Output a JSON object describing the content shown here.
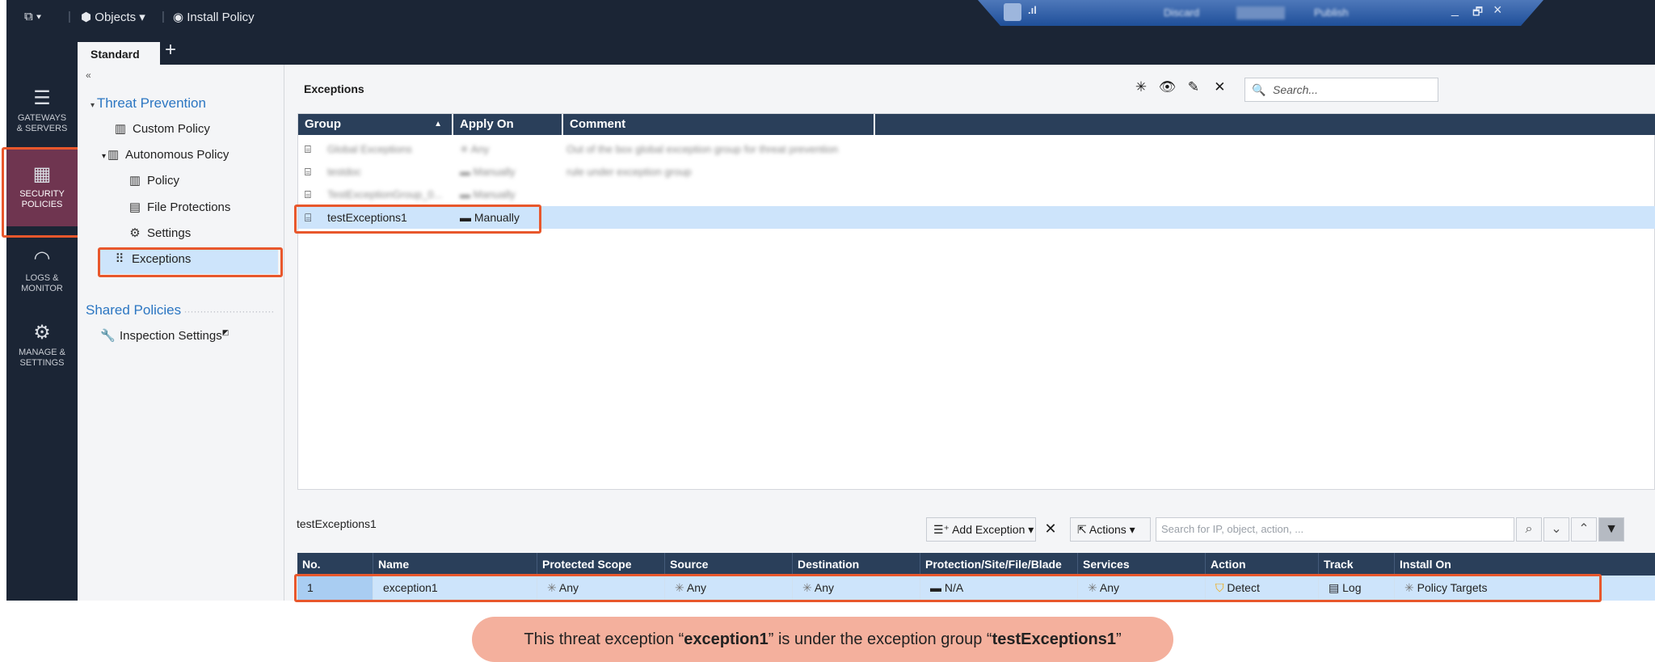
{
  "topbar": {
    "app_menu_icon": "app-menu-icon",
    "objects_label": "Objects",
    "install_policy_label": "Install Policy",
    "discard_label": "Discard",
    "publish_label": "Publish",
    "minimize": "_",
    "restore": "🗗",
    "close": "×"
  },
  "tabs": {
    "active": "Standard",
    "add": "+"
  },
  "leftnav": [
    {
      "label_line1": "GATEWAYS",
      "label_line2": "& SERVERS",
      "icon": "server-icon"
    },
    {
      "label_line1": "SECURITY",
      "label_line2": "POLICIES",
      "icon": "policy-grid-icon"
    },
    {
      "label_line1": "LOGS &",
      "label_line2": "MONITOR",
      "icon": "gauge-icon"
    },
    {
      "label_line1": "MANAGE &",
      "label_line2": "SETTINGS",
      "icon": "gear-icon"
    }
  ],
  "tree": {
    "collapse": "«",
    "threat_prevention": "Threat Prevention",
    "custom_policy": "Custom Policy",
    "autonomous_policy": "Autonomous Policy",
    "policy": "Policy",
    "file_protections": "File Protections",
    "settings": "Settings",
    "exceptions": "Exceptions",
    "shared_policies": "Shared Policies",
    "inspection_settings": "Inspection Settings"
  },
  "exceptions_panel": {
    "title": "Exceptions",
    "search_placeholder": "Search...",
    "columns": [
      "Group",
      "Apply On",
      "Comment"
    ],
    "rows": [
      {
        "group": "Global Exceptions",
        "apply_on": "Any",
        "comment": "Out of the box global exception group for threat prevention",
        "blurred": true
      },
      {
        "group": "testdoc",
        "apply_on": "Manually",
        "comment": "rule under exception group",
        "blurred": true
      },
      {
        "group": "TestExceptionGroup_0...",
        "apply_on": "Manually",
        "comment": "",
        "blurred": true
      },
      {
        "group": "testExceptions1",
        "apply_on": "Manually",
        "comment": "",
        "blurred": false
      }
    ]
  },
  "rules_panel": {
    "group_label": "testExceptions1",
    "add_exception": "Add Exception",
    "delete": "✕",
    "actions": "Actions",
    "search_placeholder": "Search for IP, object, action, ...",
    "columns": [
      "No.",
      "Name",
      "Protected Scope",
      "Source",
      "Destination",
      "Protection/Site/File/Blade",
      "Services",
      "Action",
      "Track",
      "Install On"
    ],
    "row": {
      "no": "1",
      "name": "exception1",
      "protected_scope": "Any",
      "source": "Any",
      "destination": "Any",
      "protection": "N/A",
      "services": "Any",
      "action": "Detect",
      "track": "Log",
      "install_on": "Policy Targets"
    }
  },
  "caption": {
    "prefix": "This threat exception “",
    "exception": "exception1",
    "middle": "” is under the exception group “",
    "group": "testExceptions1",
    "suffix": "”"
  },
  "colors": {
    "dark_chrome": "#1b2535",
    "grid_header": "#2a3f5a",
    "selection": "#cde4fb",
    "highlight": "#e8572c",
    "caption_bg": "#f4b09d",
    "link_blue": "#2b76c2"
  }
}
